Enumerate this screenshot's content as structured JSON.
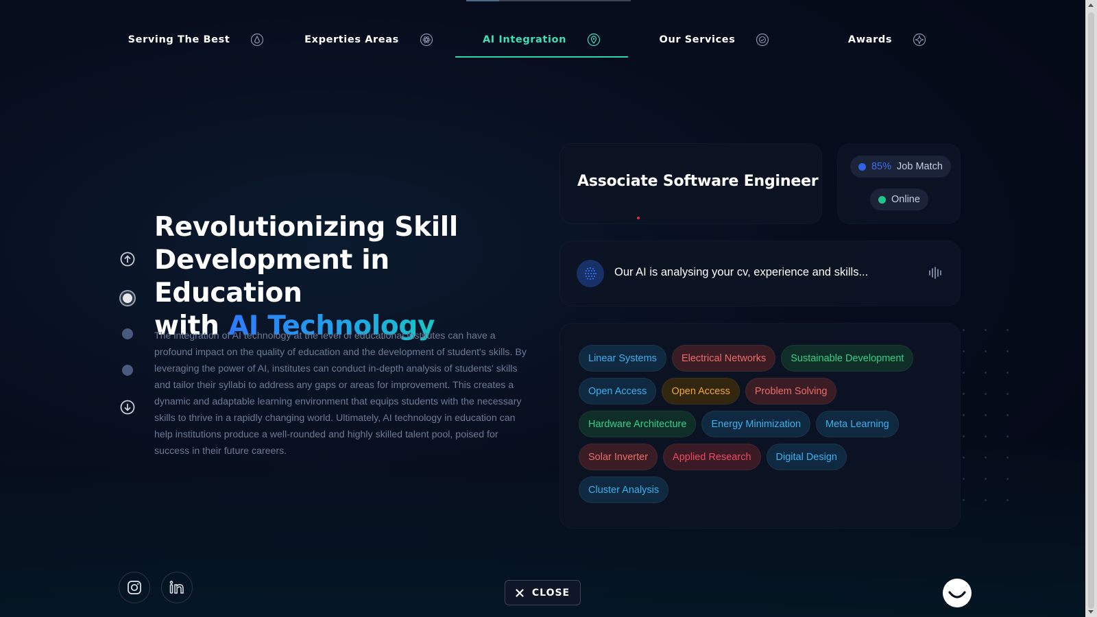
{
  "nav": {
    "tabs": [
      {
        "label": "Serving The Best",
        "icon": "drop-icon"
      },
      {
        "label": "Experties Areas",
        "icon": "atom-icon"
      },
      {
        "label": "AI Integration",
        "icon": "location-pin-icon",
        "active": true
      },
      {
        "label": "Our Services",
        "icon": "badge-icon"
      },
      {
        "label": "Awards",
        "icon": "compass-icon"
      }
    ],
    "active_color": "#3fe0b5"
  },
  "hero": {
    "title_line1": "Revolutionizing Skill",
    "title_line2": "Development in Education",
    "title_line3_prefix": "with",
    "title_accent": "AI Technology",
    "body": "The integration of AI technology at the level of educational institutes can have a profound impact on the quality of education and the development of student's skills. By leveraging the power of AI, institutes can conduct in-depth analysis of students' skills and tailor their syllabi to address any gaps or areas for improvement. This creates a dynamic and adaptable learning environment that equips students with the necessary skills to thrive in a rapidly changing world. Ultimately, AI technology in education can help institutions produce a well-rounded and highly skilled talent pool, poised for success in their future careers."
  },
  "job_card": {
    "title": "Associate Software Engineer"
  },
  "status": {
    "match_percent": "85%",
    "match_label": "Job Match",
    "online_label": "Online",
    "match_color": "#2f63e8",
    "online_color": "#22c58b"
  },
  "ai_status": {
    "text": "Our AI is analysing your cv, experience and skills..."
  },
  "tags": [
    {
      "label": "Linear Systems",
      "color": "#3ab0f0",
      "bg": "#0f2a40"
    },
    {
      "label": "Electrical Networks",
      "color": "#f06a6a",
      "bg": "#3a1c24"
    },
    {
      "label": "Sustainable Development",
      "color": "#2fd28a",
      "bg": "#0e2e27"
    },
    {
      "label": "Open Access",
      "color": "#3ab0f0",
      "bg": "#0f2a40"
    },
    {
      "label": "Open Access",
      "color": "#f0a830",
      "bg": "#33260f"
    },
    {
      "label": "Problem Solving",
      "color": "#f06a6a",
      "bg": "#3a1c24"
    },
    {
      "label": "Hardware Architecture",
      "color": "#2fd28a",
      "bg": "#0e2e27"
    },
    {
      "label": "Energy Minimization",
      "color": "#3ab0f0",
      "bg": "#0f2a40"
    },
    {
      "label": "Meta Learning",
      "color": "#3ab0f0",
      "bg": "#0f2a40"
    },
    {
      "label": "Solar Inverter",
      "color": "#f06a6a",
      "bg": "#3a1c24"
    },
    {
      "label": "Applied Research",
      "color": "#f0485e",
      "bg": "#3a1a25"
    },
    {
      "label": "Digital Design",
      "color": "#3ab0f0",
      "bg": "#0f2a40"
    },
    {
      "label": "Cluster Analysis",
      "color": "#3ab0f0",
      "bg": "#0f2a40"
    }
  ],
  "footer": {
    "close_label": "CLOSE",
    "social": [
      "instagram-icon",
      "linkedin-icon"
    ]
  }
}
